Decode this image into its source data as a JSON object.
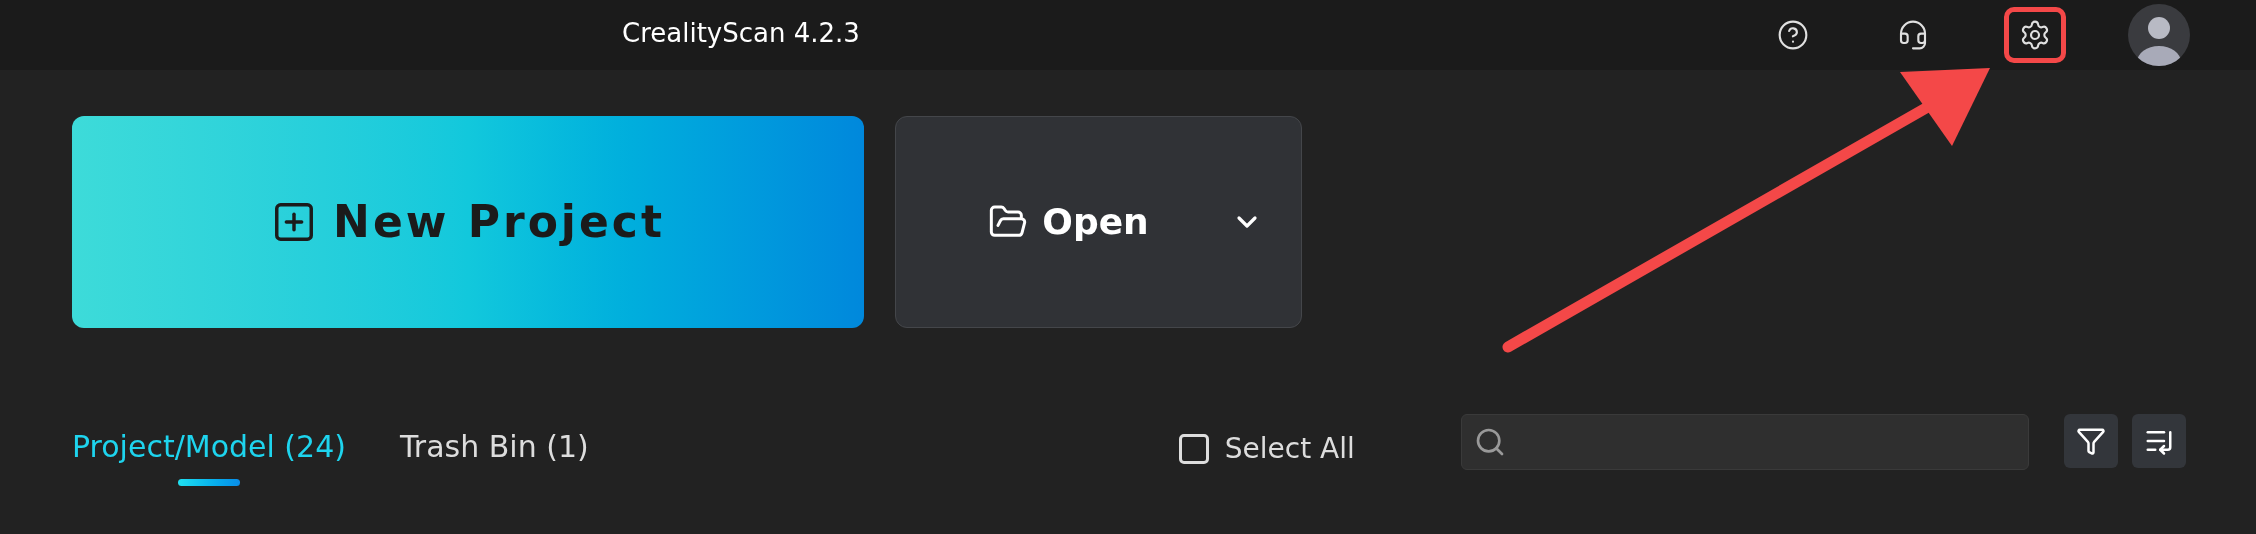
{
  "window": {
    "title": "CrealityScan 4.2.3"
  },
  "actions": {
    "new_project": "New Project",
    "open": "Open"
  },
  "tabs": [
    {
      "label": "Project/Model (24)",
      "selected": true
    },
    {
      "label": "Trash Bin (1)",
      "selected": false
    }
  ],
  "select_all": {
    "label": "Select All",
    "checked": false
  }
}
